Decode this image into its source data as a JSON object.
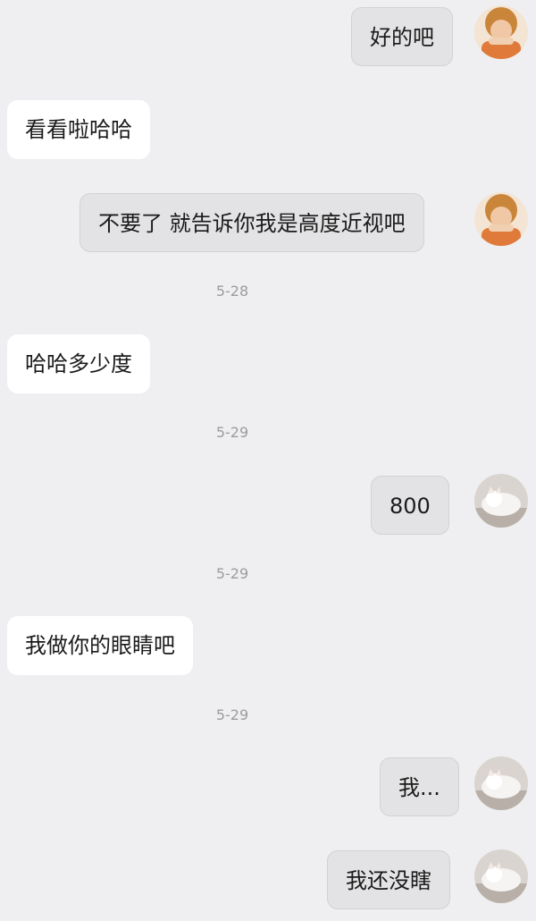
{
  "messages": [
    {
      "text": "好的吧"
    },
    {
      "text": "看看啦哈哈"
    },
    {
      "text": "不要了 就告诉你我是高度近视吧"
    },
    {
      "text": "哈哈多少度"
    },
    {
      "text": "800"
    },
    {
      "text": "我做你的眼睛吧"
    },
    {
      "text": "我..."
    },
    {
      "text": "我还没瞎"
    }
  ],
  "timestamps": [
    "5-28",
    "5-29",
    "5-29",
    "5-29"
  ]
}
